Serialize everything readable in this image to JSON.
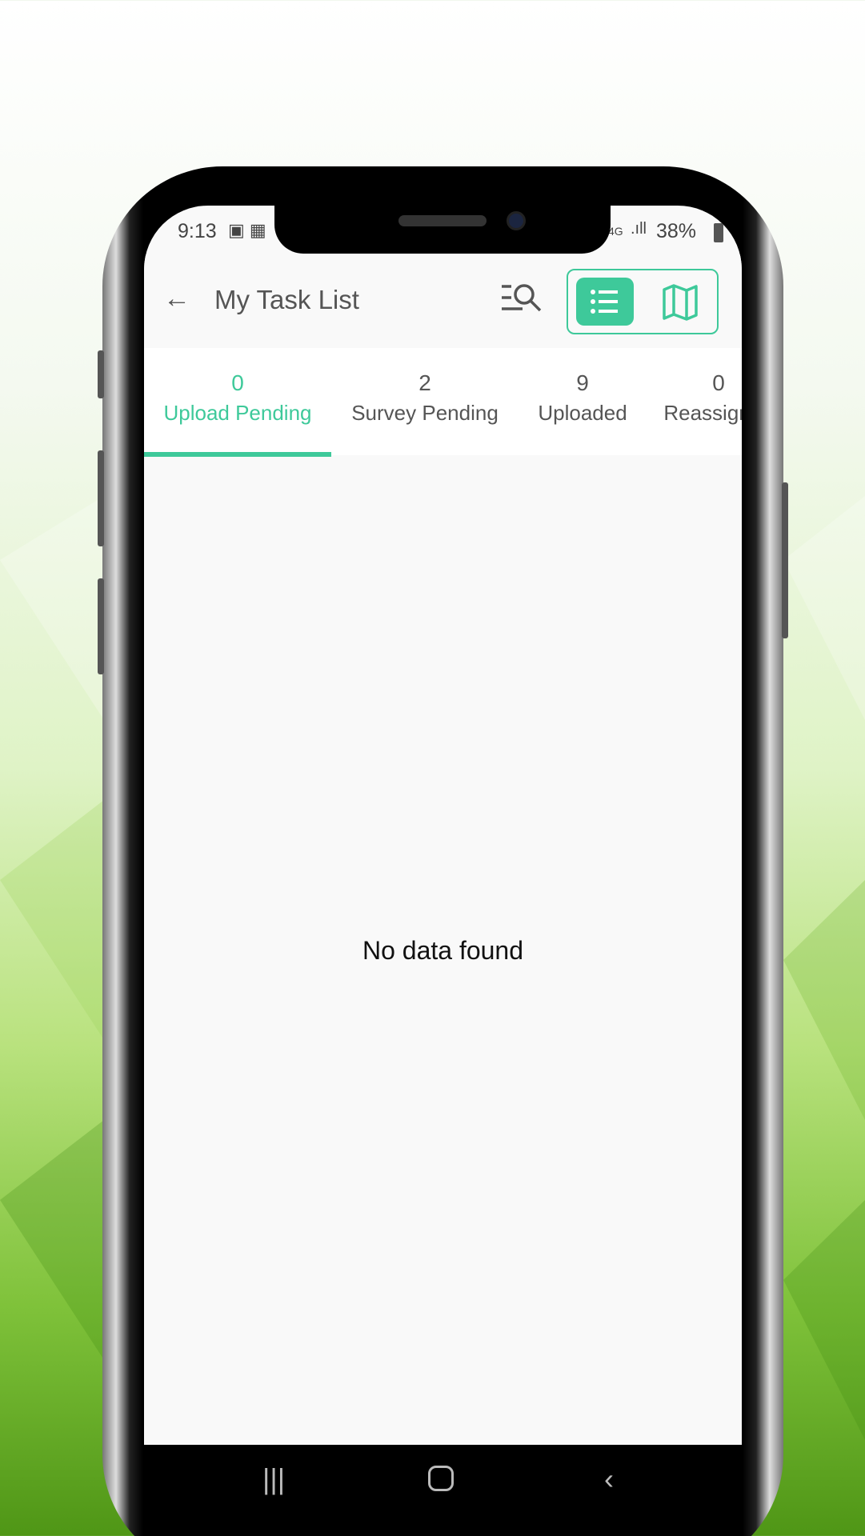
{
  "status_bar": {
    "time": "9:13",
    "network": "4G",
    "battery": "38%"
  },
  "header": {
    "title": "My Task List",
    "back_icon": "arrow-left-icon",
    "filter_icon": "filter-search-icon",
    "view_list_icon": "list-icon",
    "view_map_icon": "map-icon"
  },
  "tabs": [
    {
      "count": "0",
      "label": "Upload Pending",
      "active": true
    },
    {
      "count": "2",
      "label": "Survey Pending"
    },
    {
      "count": "9",
      "label": "Uploaded"
    },
    {
      "count": "0",
      "label": "Reassigned"
    }
  ],
  "empty_message": "No data found",
  "colors": {
    "accent": "#3ec99a"
  }
}
